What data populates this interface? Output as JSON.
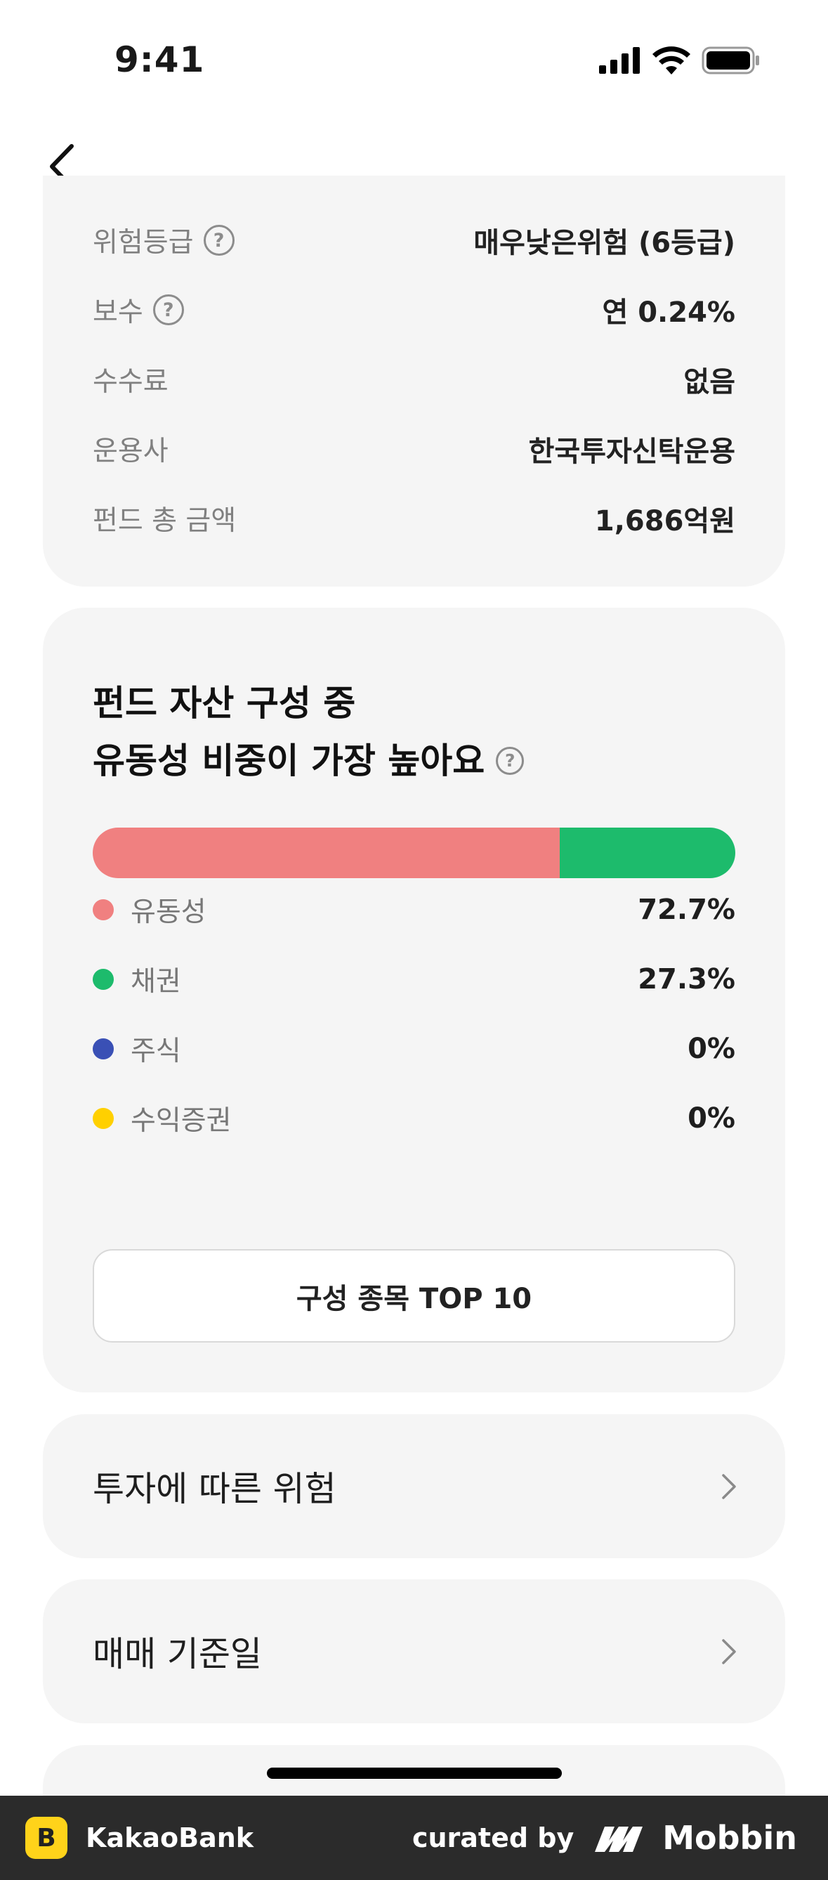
{
  "status_bar": {
    "time": "9:41",
    "signal_icon": "cellular-signal-icon",
    "wifi_icon": "wifi-icon",
    "battery_icon": "battery-icon"
  },
  "nav": {
    "back_icon": "chevron-left-icon"
  },
  "fund_info": {
    "rows": [
      {
        "label": "위험등급",
        "value": "매우낮은위험 (6등급)",
        "has_help": true
      },
      {
        "label": "보수",
        "value": "연 0.24%",
        "has_help": true
      },
      {
        "label": "수수료",
        "value": "없음",
        "has_help": false
      },
      {
        "label": "운용사",
        "value": "한국투자신탁운용",
        "has_help": false
      },
      {
        "label": "펀드 총 금액",
        "value": "1,686억원",
        "has_help": false
      }
    ],
    "help_glyph": "?"
  },
  "asset_composition": {
    "title_line1": "펀드 자산 구성 중",
    "title_line2": "유동성 비중이 가장 높아요",
    "legend": [
      {
        "label": "유동성",
        "value": "72.7%",
        "share": 72.7,
        "color": "#f08080"
      },
      {
        "label": "채권",
        "value": "27.3%",
        "share": 27.3,
        "color": "#1dbb6c"
      },
      {
        "label": "주식",
        "value": "0%",
        "share": 0,
        "color": "#3a50b5"
      },
      {
        "label": "수익증권",
        "value": "0%",
        "share": 0,
        "color": "#ffd000"
      }
    ],
    "top10_button": "구성 종목 TOP 10"
  },
  "links": {
    "risk": "투자에 따른 위험",
    "trade_date": "매매 기준일",
    "chevron_icon": "chevron-right-icon"
  },
  "footer": {
    "logo_letter": "B",
    "app_name": "KakaoBank",
    "curated_by": "curated by",
    "brand": "Mobbin"
  }
}
